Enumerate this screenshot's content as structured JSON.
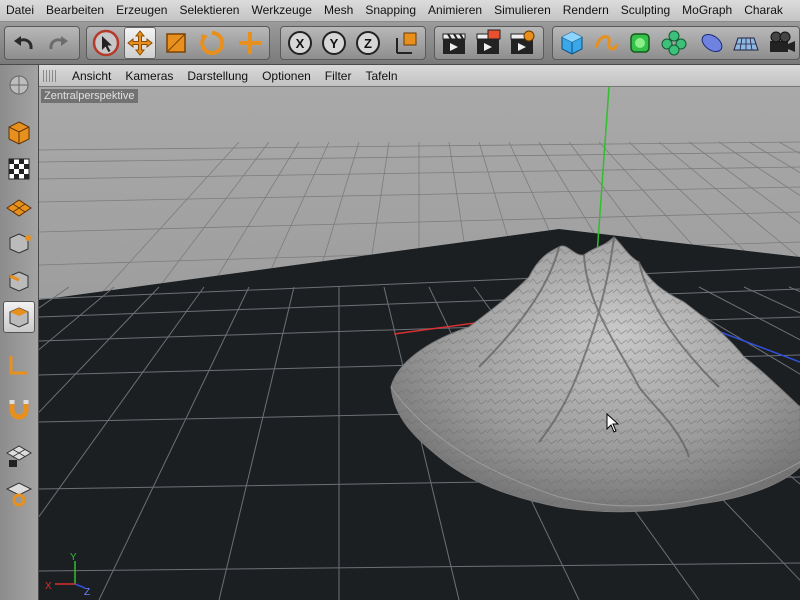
{
  "menu": [
    "Datei",
    "Bearbeiten",
    "Erzeugen",
    "Selektieren",
    "Werkzeuge",
    "Mesh",
    "Snapping",
    "Animieren",
    "Simulieren",
    "Rendern",
    "Sculpting",
    "MoGraph",
    "Charak"
  ],
  "toolbar": {
    "axis_x": "X",
    "axis_y": "Y",
    "axis_z": "Z"
  },
  "viewport": {
    "menu": [
      "Ansicht",
      "Kameras",
      "Darstellung",
      "Optionen",
      "Filter",
      "Tafeln"
    ],
    "camera_label": "Zentralperspektive",
    "axis_labels": {
      "x": "X",
      "y": "Y",
      "z": "Z"
    }
  },
  "colors": {
    "accent_orange": "#e8901e",
    "axis_x": "#d63030",
    "axis_y": "#2fbf2f",
    "axis_z": "#3050d8",
    "floor": "#1c1f22",
    "sky": "#9a9a9a"
  }
}
